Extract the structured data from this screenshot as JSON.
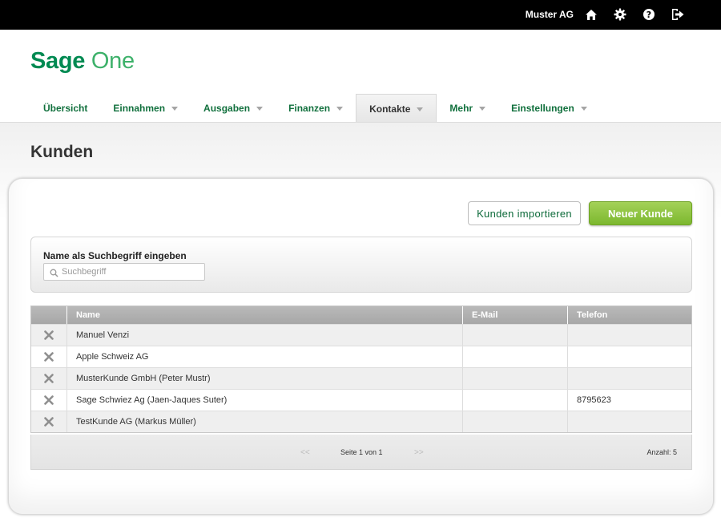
{
  "topbar": {
    "company": "Muster AG",
    "icons": [
      "home-icon",
      "gear-icon",
      "help-icon",
      "logout-icon"
    ]
  },
  "logo": {
    "part1": "Sage",
    "part2": "One"
  },
  "nav": {
    "items": [
      {
        "label": "Übersicht",
        "dropdown": false,
        "active": false
      },
      {
        "label": "Einnahmen",
        "dropdown": true,
        "active": false
      },
      {
        "label": "Ausgaben",
        "dropdown": true,
        "active": false
      },
      {
        "label": "Finanzen",
        "dropdown": true,
        "active": false
      },
      {
        "label": "Kontakte",
        "dropdown": true,
        "active": true
      },
      {
        "label": "Mehr",
        "dropdown": true,
        "active": false
      },
      {
        "label": "Einstellungen",
        "dropdown": true,
        "active": false
      }
    ]
  },
  "page": {
    "title": "Kunden"
  },
  "actions": {
    "import_label": "Kunden importieren",
    "new_label": "Neuer Kunde"
  },
  "search": {
    "label": "Name als Suchbegriff eingeben",
    "placeholder": "Suchbegriff",
    "value": ""
  },
  "table": {
    "columns": [
      "",
      "Name",
      "E-Mail",
      "Telefon"
    ],
    "rows": [
      {
        "name": "Manuel Venzi",
        "email": "",
        "phone": ""
      },
      {
        "name": "Apple Schweiz AG",
        "email": "",
        "phone": ""
      },
      {
        "name": "MusterKunde GmbH (Peter Mustr)",
        "email": "",
        "phone": ""
      },
      {
        "name": "Sage Schwiez Ag (Jaen-Jaques Suter)",
        "email": "",
        "phone": "8795623"
      },
      {
        "name": "TestKunde AG (Markus Müller)",
        "email": "",
        "phone": ""
      }
    ]
  },
  "pager": {
    "prev": "<<",
    "page_text": "Seite 1 von 1",
    "next": ">>",
    "count": "Anzahl: 5"
  },
  "colors": {
    "brand": "#008a52",
    "brand_light": "#3db16a",
    "button_green": "#8cc43f",
    "nav_text": "#11703d"
  }
}
